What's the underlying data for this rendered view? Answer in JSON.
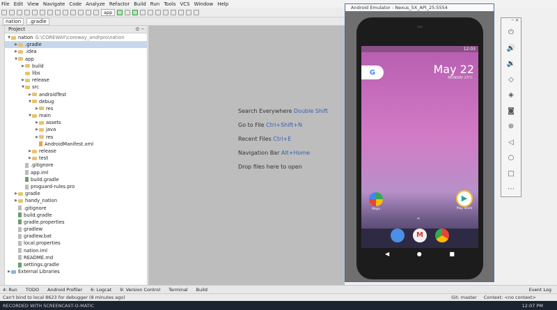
{
  "menu": [
    "File",
    "Edit",
    "View",
    "Navigate",
    "Code",
    "Analyze",
    "Refactor",
    "Build",
    "Run",
    "Tools",
    "VCS",
    "Window",
    "Help"
  ],
  "toolbar": {
    "run_config": "app"
  },
  "nav": {
    "crumb1": "nation",
    "crumb2": ".gradle"
  },
  "project": {
    "header": "Project",
    "rows": [
      {
        "label": "nation",
        "extra": "G:\\COREWAY\\coreway_andrpro\\nation",
        "indent": 0,
        "icon": "folder-icon",
        "open": true
      },
      {
        "label": ".gradle",
        "indent": 1,
        "icon": "folder-icon",
        "open": false,
        "selected": true
      },
      {
        "label": ".idea",
        "indent": 1,
        "icon": "folder-icon",
        "open": false
      },
      {
        "label": "app",
        "indent": 1,
        "icon": "folder-icon",
        "open": true
      },
      {
        "label": "build",
        "indent": 2,
        "icon": "folder-icon",
        "open": false
      },
      {
        "label": "libs",
        "indent": 2,
        "icon": "folder-icon"
      },
      {
        "label": "release",
        "indent": 2,
        "icon": "folder-icon",
        "open": false
      },
      {
        "label": "src",
        "indent": 2,
        "icon": "folder-icon",
        "open": true
      },
      {
        "label": "androidTest",
        "indent": 3,
        "icon": "folder-icon",
        "open": false
      },
      {
        "label": "debug",
        "indent": 3,
        "icon": "folder-icon",
        "open": true
      },
      {
        "label": "res",
        "indent": 4,
        "icon": "folder-icon",
        "open": false
      },
      {
        "label": "main",
        "indent": 3,
        "icon": "folder-icon",
        "open": true
      },
      {
        "label": "assets",
        "indent": 4,
        "icon": "folder-icon",
        "open": false
      },
      {
        "label": "java",
        "indent": 4,
        "icon": "folder-icon",
        "open": false
      },
      {
        "label": "res",
        "indent": 4,
        "icon": "folder-icon",
        "open": false
      },
      {
        "label": "AndroidManifest.xml",
        "indent": 4,
        "icon": "xml-file-icon",
        "file": true
      },
      {
        "label": "release",
        "indent": 3,
        "icon": "folder-icon",
        "open": false
      },
      {
        "label": "test",
        "indent": 3,
        "icon": "folder-icon",
        "open": false
      },
      {
        "label": ".gitignore",
        "indent": 2,
        "icon": "file-icon",
        "file": true
      },
      {
        "label": "app.iml",
        "indent": 2,
        "icon": "file-icon",
        "file": true
      },
      {
        "label": "build.gradle",
        "indent": 2,
        "icon": "gradle-file-icon",
        "file": true
      },
      {
        "label": "proguard-rules.pro",
        "indent": 2,
        "icon": "file-icon",
        "file": true
      },
      {
        "label": "gradle",
        "indent": 1,
        "icon": "folder-icon",
        "open": false
      },
      {
        "label": "handy_nation",
        "indent": 1,
        "icon": "folder-icon",
        "open": false
      },
      {
        "label": ".gitignore",
        "indent": 1,
        "icon": "file-icon",
        "file": true
      },
      {
        "label": "build.gradle",
        "indent": 1,
        "icon": "gradle-file-icon",
        "file": true
      },
      {
        "label": "gradle.properties",
        "indent": 1,
        "icon": "gradle-file-icon",
        "file": true
      },
      {
        "label": "gradlew",
        "indent": 1,
        "icon": "file-icon",
        "file": true
      },
      {
        "label": "gradlew.bat",
        "indent": 1,
        "icon": "file-icon",
        "file": true
      },
      {
        "label": "local.properties",
        "indent": 1,
        "icon": "file-icon",
        "file": true
      },
      {
        "label": "nation.iml",
        "indent": 1,
        "icon": "file-icon",
        "file": true
      },
      {
        "label": "README.md",
        "indent": 1,
        "icon": "file-icon",
        "file": true
      },
      {
        "label": "settings.gradle",
        "indent": 1,
        "icon": "gradle-file-icon",
        "file": true
      },
      {
        "label": "External Libraries",
        "indent": 0,
        "icon": "library-icon",
        "open": false
      }
    ]
  },
  "editor_hints": [
    {
      "text": "Search Everywhere",
      "key": "Double Shift"
    },
    {
      "text": "Go to File",
      "key": "Ctrl+Shift+N"
    },
    {
      "text": "Recent Files",
      "key": "Ctrl+E"
    },
    {
      "text": "Navigation Bar",
      "key": "Alt+Home"
    },
    {
      "text": "Drop files here to open",
      "key": ""
    }
  ],
  "emulator": {
    "title": "Android Emulator - Nexus_5X_API_25:5554",
    "time": "12:03",
    "date": "May 22",
    "date_sub": "MONDAY  23°C",
    "maps_label": "Maps",
    "play_label": "Play Store"
  },
  "bottom_tabs": [
    "4: Run",
    "TODO",
    "Android Profiler",
    "6: Logcat",
    "9: Version Control",
    "Terminal",
    "Build",
    "Event Log"
  ],
  "status": {
    "message": "Can't bind to local 8623 for debugger (8 minutes ago)",
    "git": "Git: master",
    "context": "Context: <no context>"
  },
  "taskbar": {
    "watermark": "RECORDED WITH SCREENCAST-O-MATIC",
    "time": "12:07 PM"
  },
  "colors": {
    "accent": "#4a6fa0",
    "selection": "#c7d8ee"
  }
}
